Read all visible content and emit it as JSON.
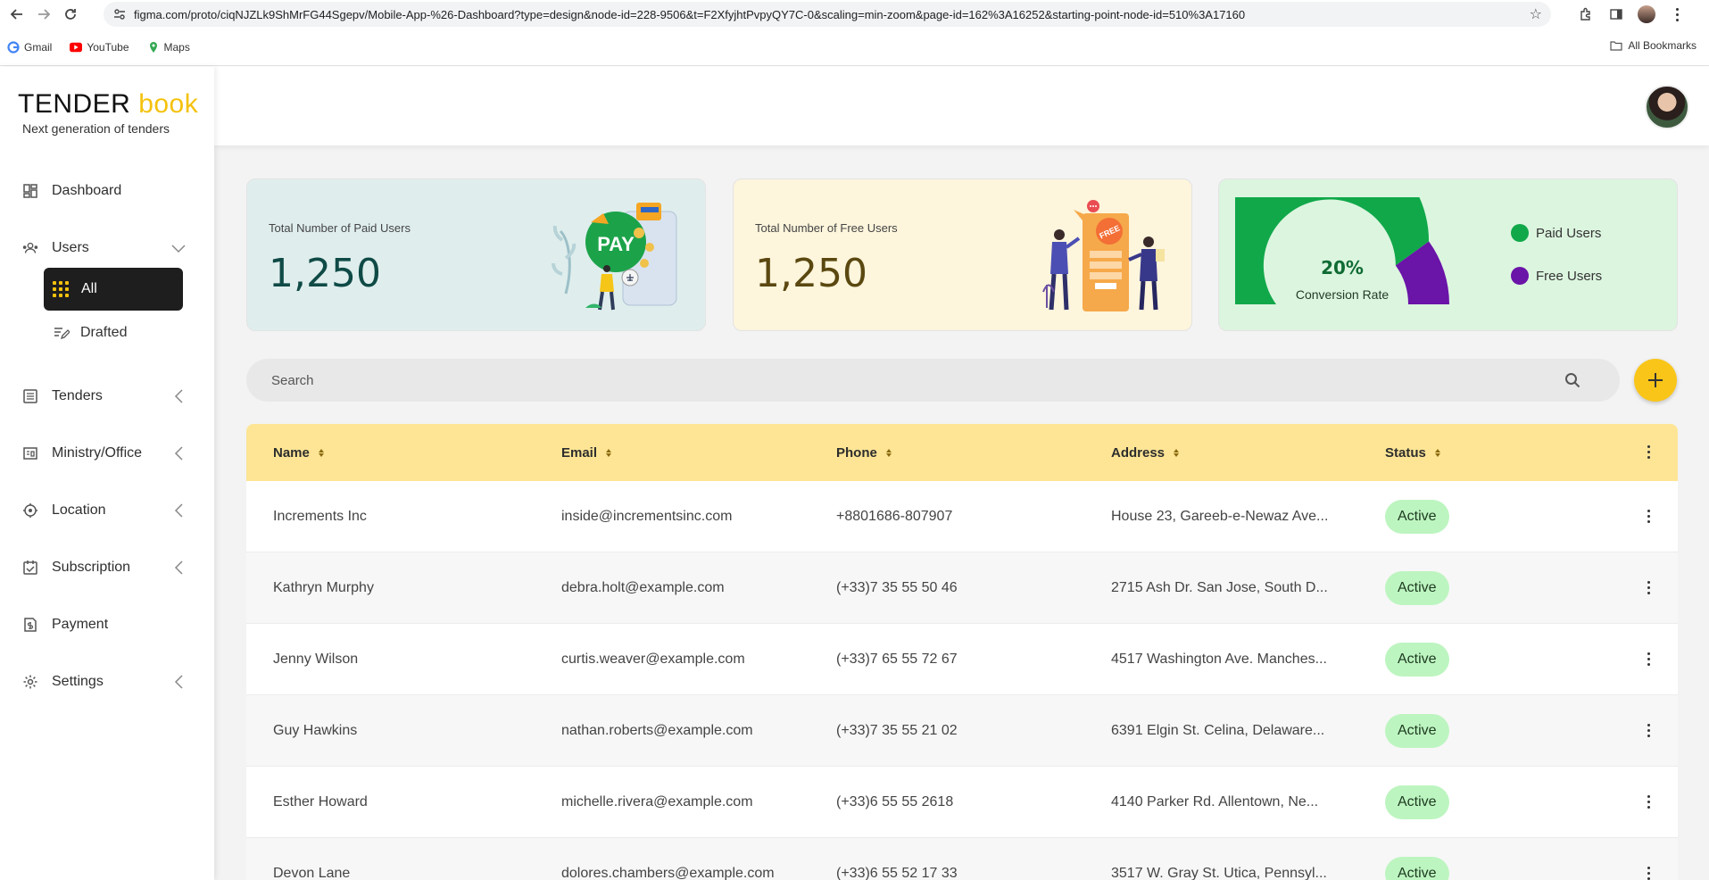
{
  "browser": {
    "url": "figma.com/proto/ciqNJZLk9ShMrFG44Sgepv/Mobile-App-%26-Dashboard?type=design&node-id=228-9506&t=F2XfyjhtPvpyQY7C-0&scaling=min-zoom&page-id=162%3A16252&starting-point-node-id=510%3A17160",
    "bookmarks": [
      "Gmail",
      "YouTube",
      "Maps"
    ],
    "all_bookmarks": "All Bookmarks"
  },
  "brand": {
    "name_part1": "TENDER",
    "name_part2": "book",
    "tagline": "Next generation of tenders"
  },
  "sidebar": {
    "dashboard": "Dashboard",
    "users": "Users",
    "users_sub": {
      "all": "All",
      "drafted": "Drafted"
    },
    "tenders": "Tenders",
    "ministry": "Ministry/Office",
    "location": "Location",
    "subscription": "Subscription",
    "payment": "Payment",
    "settings": "Settings"
  },
  "stats": {
    "paid_label": "Total Number of Paid Users",
    "paid_value": "1,250",
    "free_label": "Total Number of Free Users",
    "free_value": "1,250",
    "conversion_value": "20%",
    "conversion_label": "Conversion Rate",
    "conversion_fraction": 0.2,
    "legend_paid": "Paid Users",
    "legend_free": "Free Users",
    "colors": {
      "paid": "#11a84a",
      "free": "#6a14a8"
    },
    "illus_paid_text": "PAY",
    "illus_free_text": "FREE"
  },
  "search": {
    "placeholder": "Search"
  },
  "table": {
    "headers": {
      "name": "Name",
      "email": "Email",
      "phone": "Phone",
      "address": "Address",
      "status": "Status"
    },
    "rows": [
      {
        "name": "Increments Inc",
        "email": "inside@incrementsinc.com",
        "phone": "+8801686-807907",
        "address": "House 23, Gareeb-e-Newaz Ave...",
        "status": "Active"
      },
      {
        "name": "Kathryn Murphy",
        "email": "debra.holt@example.com",
        "phone": "(+33)7 35 55 50 46",
        "address": "2715 Ash Dr. San Jose, South D...",
        "status": "Active"
      },
      {
        "name": "Jenny Wilson",
        "email": "curtis.weaver@example.com",
        "phone": "(+33)7 65 55 72 67",
        "address": "4517 Washington Ave. Manches...",
        "status": "Active"
      },
      {
        "name": "Guy Hawkins",
        "email": "nathan.roberts@example.com",
        "phone": "(+33)7 35 55 21 02",
        "address": "6391 Elgin St. Celina, Delaware...",
        "status": "Active"
      },
      {
        "name": "Esther Howard",
        "email": "michelle.rivera@example.com",
        "phone": "(+33)6 55 55 2618",
        "address": "4140 Parker Rd. Allentown, Ne...",
        "status": "Active"
      },
      {
        "name": "Devon Lane",
        "email": "dolores.chambers@example.com",
        "phone": "(+33)6 55 52 17 33",
        "address": "3517 W. Gray St. Utica, Pennsyl...",
        "status": "Active"
      }
    ]
  }
}
